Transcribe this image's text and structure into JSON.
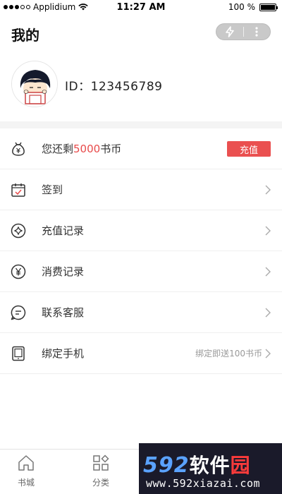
{
  "status_bar": {
    "carrier": "Applidium",
    "time": "11:27 AM",
    "battery_text": "100 %"
  },
  "header": {
    "title": "我的"
  },
  "profile": {
    "id_text": "ID：123456789"
  },
  "list": {
    "balance_prefix": "您还剩",
    "balance_amount": "5000",
    "balance_suffix": "书币",
    "recharge_button": "充值",
    "items": [
      {
        "label": "签到"
      },
      {
        "label": "充值记录"
      },
      {
        "label": "消费记录"
      },
      {
        "label": "联系客服"
      },
      {
        "label": "绑定手机",
        "extra": "绑定即送100书币"
      }
    ]
  },
  "tabbar": {
    "tabs": [
      {
        "label": "书城"
      },
      {
        "label": "分类"
      }
    ]
  },
  "watermark": {
    "line1_num": "592",
    "line1_cn": "软件",
    "line1_red": "园",
    "line2": "www.592xiazai.com"
  },
  "colors": {
    "accent": "#ea5050",
    "balance_number": "#e84a4a"
  }
}
